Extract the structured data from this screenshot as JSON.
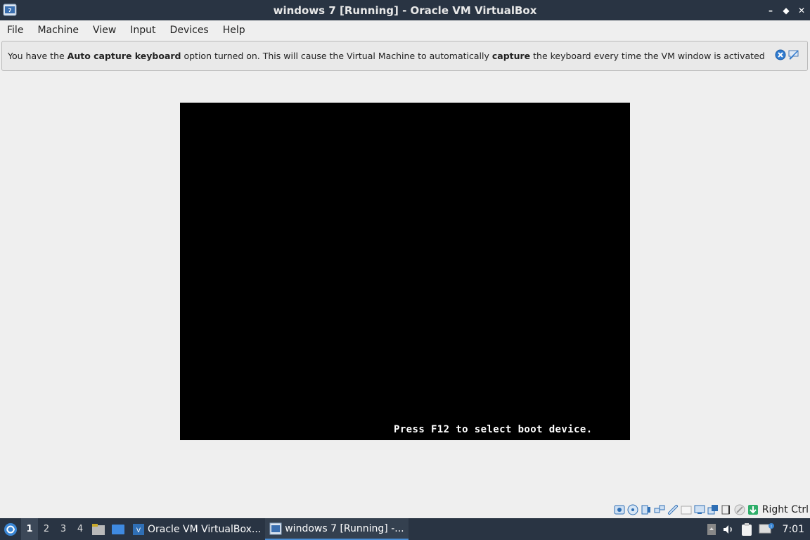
{
  "window": {
    "title": "windows 7 [Running] - Oracle VM VirtualBox",
    "controls": {
      "minimize": "–",
      "maximize": "◆",
      "close": "✕"
    }
  },
  "menu": [
    "File",
    "Machine",
    "View",
    "Input",
    "Devices",
    "Help"
  ],
  "notice": {
    "part1": "You have the ",
    "bold1": "Auto capture keyboard",
    "part2": " option turned on. This will cause the Virtual Machine to automatically ",
    "bold2": "capture",
    "part3": " the keyboard every time the VM window is activated and make it"
  },
  "vm": {
    "boot_message": "Press F12 to select boot device."
  },
  "statusbar": {
    "icons": [
      "hard-disk-icon",
      "optical-drive-icon",
      "audio-icon",
      "network-icon",
      "usb-icon",
      "shared-folders-icon",
      "display-icon",
      "video-capture-icon",
      "mouse-integration-icon",
      "keyboard-capture-icon"
    ],
    "host_key": "Right Ctrl"
  },
  "taskbar": {
    "desktops": [
      "1",
      "2",
      "3",
      "4"
    ],
    "active_desktop": "1",
    "tasks": [
      {
        "label": "Oracle VM VirtualBox...",
        "active": false
      },
      {
        "label": "windows 7 [Running] -...",
        "active": true
      }
    ],
    "clock": "7:01"
  },
  "colors": {
    "titlebar_bg": "#293443",
    "window_bg": "#efefef",
    "vm_bg": "#000000",
    "accent": "#4b8fd6"
  }
}
